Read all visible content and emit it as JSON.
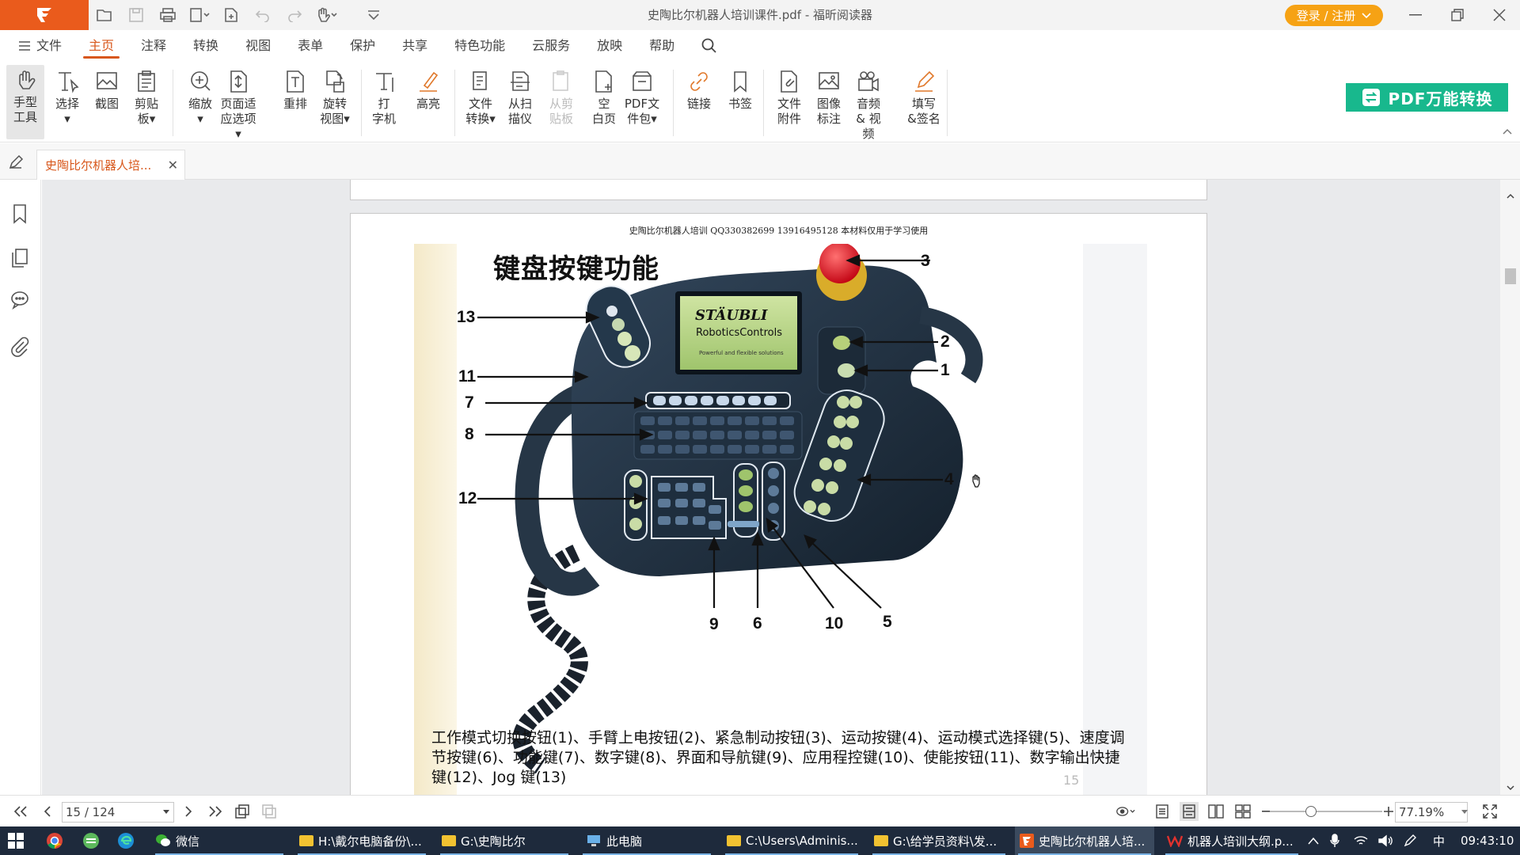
{
  "app": {
    "title": "史陶比尔机器人培训课件.pdf - 福昕阅读器",
    "login_label": "登录 / 注册"
  },
  "menu": {
    "items": [
      "文件",
      "主页",
      "注释",
      "转换",
      "视图",
      "表单",
      "保护",
      "共享",
      "特色功能",
      "云服务",
      "放映",
      "帮助"
    ],
    "active": "主页"
  },
  "ribbon": {
    "tools": [
      {
        "label": "手型\n工具",
        "icon": "hand-icon"
      },
      {
        "label": "选择\n▾",
        "icon": "select-text-icon"
      },
      {
        "label": "截图",
        "icon": "snapshot-icon"
      },
      {
        "label": "剪贴\n板▾",
        "icon": "clipboard-icon"
      },
      {
        "label": "缩放\n▾",
        "icon": "zoom-icon"
      },
      {
        "label": "页面适\n应选项▾",
        "icon": "fit-page-icon"
      },
      {
        "label": "重排",
        "icon": "reflow-icon"
      },
      {
        "label": "旋转\n视图▾",
        "icon": "rotate-view-icon"
      },
      {
        "label": "打\n字机",
        "icon": "typewriter-icon"
      },
      {
        "label": "高亮",
        "icon": "highlight-icon"
      },
      {
        "label": "文件\n转换▾",
        "icon": "file-convert-icon"
      },
      {
        "label": "从扫\n描仪",
        "icon": "scanner-icon"
      },
      {
        "label": "从剪\n贴板",
        "icon": "from-clipboard-icon"
      },
      {
        "label": "空\n白页",
        "icon": "blank-page-icon"
      },
      {
        "label": "PDF文\n件包▾",
        "icon": "pdf-package-icon"
      },
      {
        "label": "链接",
        "icon": "link-icon"
      },
      {
        "label": "书签",
        "icon": "bookmark-icon"
      },
      {
        "label": "文件\n附件",
        "icon": "file-attachment-icon"
      },
      {
        "label": "图像\n标注",
        "icon": "image-annotation-icon"
      },
      {
        "label": "音频\n& 视频",
        "icon": "audio-video-icon"
      },
      {
        "label": "填写\n&签名",
        "icon": "fill-sign-icon"
      }
    ],
    "pdf_convert_label": "PDF万能转换"
  },
  "tab": {
    "label": "史陶比尔机器人培..."
  },
  "document": {
    "header": "史陶比尔机器人培训    QQ330382699  13916495128  本材料仅用于学习使用",
    "slide_title": "键盘按键功能",
    "brand_line1": "STÄUBLI",
    "brand_line2": "RoboticsControls",
    "brand_line3": "Powerful and flexible solutions",
    "callouts": [
      "1",
      "2",
      "3",
      "4",
      "5",
      "6",
      "7",
      "8",
      "9",
      "10",
      "11",
      "12",
      "13"
    ],
    "caption": "工作模式切换按钮(1)、手臂上电按钮(2)、紧急制动按钮(3)、运动按键(4)、运动模式选择键(5)、速度调节按键(6)、功能键(7)、数字键(8)、界面和导航键(9)、应用程控键(10)、使能按钮(11)、数字输出快捷键(12)、Jog 键(13)",
    "page_mark": "15"
  },
  "status": {
    "page": "15 / 124",
    "zoom": "77.19%"
  },
  "taskbar": {
    "items": [
      "微信",
      "H:\\戴尔电脑备份\\...",
      "G:\\史陶比尔",
      "此电脑",
      "C:\\Users\\Adminis...",
      "G:\\给学员资料\\发...",
      "史陶比尔机器人培...",
      "机器人培训大纲.p..."
    ],
    "ime": "中",
    "time": "09:43:10"
  },
  "colors": {
    "accent": "#d8571b",
    "login": "#f6a214",
    "convert": "#18b88d",
    "taskbar": "#1e2a3c"
  }
}
